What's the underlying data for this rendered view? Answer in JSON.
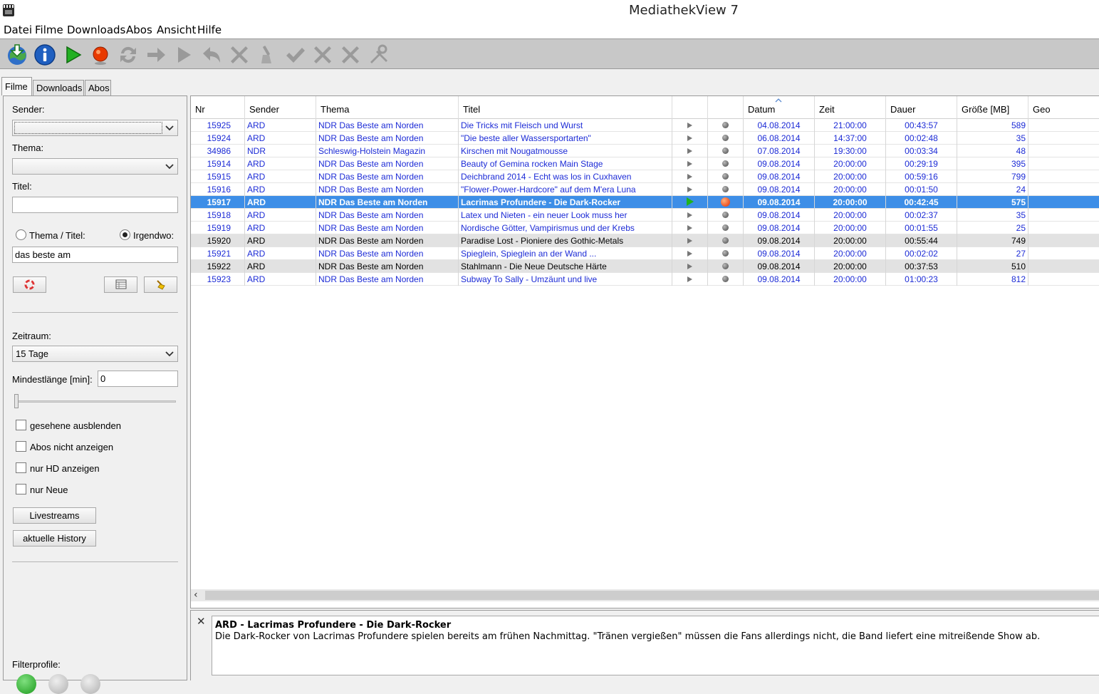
{
  "window": {
    "title": "MediathekView 7"
  },
  "menu": [
    "Datei",
    "Filme",
    "Downloads",
    "Abos",
    "Ansicht",
    "Hilfe"
  ],
  "toolbar": {
    "icons": [
      "update-films-icon",
      "info-icon",
      "play-icon",
      "record-icon",
      "refresh-icon",
      "forward-arrow-icon",
      "play-gray-icon",
      "undo-icon",
      "delete-icon",
      "clean-icon",
      "check-icon",
      "remove-icon",
      "remove-all-icon",
      "tools-icon"
    ]
  },
  "tabs": [
    "Filme",
    "Downloads",
    "Abos"
  ],
  "filter": {
    "sender_label": "Sender:",
    "sender_value": "",
    "thema_label": "Thema:",
    "thema_value": "",
    "titel_label": "Titel:",
    "titel_value": "",
    "radio_thema_titel": "Thema / Titel:",
    "radio_irgendwo": "Irgendwo:",
    "search_value": "das beste am",
    "zeitraum_label": "Zeitraum:",
    "zeitraum_value": "15 Tage",
    "mindestlaenge_label": "Mindestlänge [min]:",
    "mindestlaenge_value": "0",
    "checkboxes": [
      "gesehene ausblenden",
      "Abos nicht anzeigen",
      "nur HD anzeigen",
      "nur Neue"
    ],
    "livestreams_button": "Livestreams",
    "history_button": "aktuelle History",
    "filterprofile_label": "Filterprofile:"
  },
  "table": {
    "columns": [
      "Nr",
      "Sender",
      "Thema",
      "Titel",
      "",
      "",
      "Datum",
      "Zeit",
      "Dauer",
      "Größe [MB]",
      "Geo"
    ],
    "rows": [
      {
        "nr": "15925",
        "sender": "ARD",
        "thema": "NDR  Das Beste am Norden",
        "titel": "Die Tricks mit Fleisch und Wurst",
        "datum": "04.08.2014",
        "zeit": "21:00:00",
        "dauer": "00:43:57",
        "groesse": "589",
        "style": "blue"
      },
      {
        "nr": "15924",
        "sender": "ARD",
        "thema": "NDR  Das Beste am Norden",
        "titel": "\"Die beste aller Wassersportarten\"",
        "datum": "06.08.2014",
        "zeit": "14:37:00",
        "dauer": "00:02:48",
        "groesse": "35",
        "style": "blue"
      },
      {
        "nr": "34986",
        "sender": "NDR",
        "thema": "Schleswig-Holstein Magazin",
        "titel": "Kirschen mit Nougatmousse",
        "datum": "07.08.2014",
        "zeit": "19:30:00",
        "dauer": "00:03:34",
        "groesse": "48",
        "style": "blue"
      },
      {
        "nr": "15914",
        "sender": "ARD",
        "thema": "NDR  Das Beste am Norden",
        "titel": "Beauty of Gemina rocken Main Stage",
        "datum": "09.08.2014",
        "zeit": "20:00:00",
        "dauer": "00:29:19",
        "groesse": "395",
        "style": "blue"
      },
      {
        "nr": "15915",
        "sender": "ARD",
        "thema": "NDR  Das Beste am Norden",
        "titel": "Deichbrand 2014 - Echt was los in Cuxhaven",
        "datum": "09.08.2014",
        "zeit": "20:00:00",
        "dauer": "00:59:16",
        "groesse": "799",
        "style": "blue"
      },
      {
        "nr": "15916",
        "sender": "ARD",
        "thema": "NDR  Das Beste am Norden",
        "titel": "\"Flower-Power-Hardcore\" auf dem M'era Luna",
        "datum": "09.08.2014",
        "zeit": "20:00:00",
        "dauer": "00:01:50",
        "groesse": "24",
        "style": "blue"
      },
      {
        "nr": "15917",
        "sender": "ARD",
        "thema": "NDR  Das Beste am Norden",
        "titel": "Lacrimas Profundere - Die Dark-Rocker",
        "datum": "09.08.2014",
        "zeit": "20:00:00",
        "dauer": "00:42:45",
        "groesse": "575",
        "style": "sel"
      },
      {
        "nr": "15918",
        "sender": "ARD",
        "thema": "NDR  Das Beste am Norden",
        "titel": "Latex und Nieten - ein neuer Look muss her",
        "datum": "09.08.2014",
        "zeit": "20:00:00",
        "dauer": "00:02:37",
        "groesse": "35",
        "style": "blue"
      },
      {
        "nr": "15919",
        "sender": "ARD",
        "thema": "NDR  Das Beste am Norden",
        "titel": "Nordische Götter, Vampirismus und der Krebs",
        "datum": "09.08.2014",
        "zeit": "20:00:00",
        "dauer": "00:01:55",
        "groesse": "25",
        "style": "blue"
      },
      {
        "nr": "15920",
        "sender": "ARD",
        "thema": "NDR  Das Beste am Norden",
        "titel": "Paradise Lost - Pioniere des Gothic-Metals",
        "datum": "09.08.2014",
        "zeit": "20:00:00",
        "dauer": "00:55:44",
        "groesse": "749",
        "style": "gray"
      },
      {
        "nr": "15921",
        "sender": "ARD",
        "thema": "NDR  Das Beste am Norden",
        "titel": "Spieglein, Spieglein an der Wand ...",
        "datum": "09.08.2014",
        "zeit": "20:00:00",
        "dauer": "00:02:02",
        "groesse": "27",
        "style": "blue"
      },
      {
        "nr": "15922",
        "sender": "ARD",
        "thema": "NDR  Das Beste am Norden",
        "titel": "Stahlmann - Die Neue Deutsche Härte",
        "datum": "09.08.2014",
        "zeit": "20:00:00",
        "dauer": "00:37:53",
        "groesse": "510",
        "style": "gray"
      },
      {
        "nr": "15923",
        "sender": "ARD",
        "thema": "NDR  Das Beste am Norden",
        "titel": "Subway To Sally - Umzäunt und live",
        "datum": "09.08.2014",
        "zeit": "20:00:00",
        "dauer": "01:00:23",
        "groesse": "812",
        "style": "blue"
      }
    ]
  },
  "description": {
    "title": "ARD  -  Lacrimas Profundere - Die Dark-Rocker",
    "text": "Die Dark-Rocker von Lacrimas Profundere spielen bereits am frühen Nachmittag. \"Tränen vergießen\" müssen die Fans allerdings nicht, die Band liefert eine mitreißende Show ab."
  }
}
